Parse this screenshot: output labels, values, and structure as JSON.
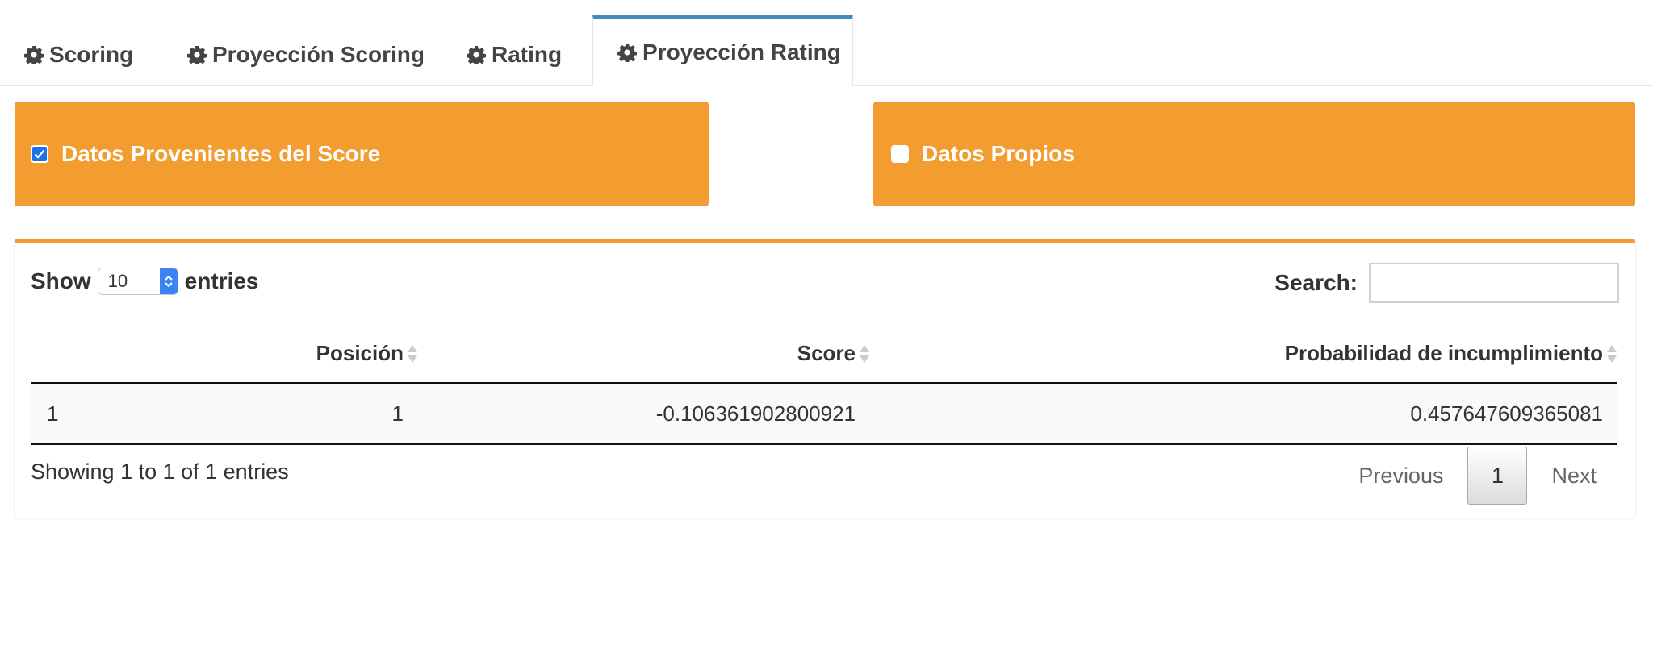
{
  "tabs": [
    {
      "label": "Scoring",
      "icon": "gear-icon"
    },
    {
      "label": "Proyección Scoring",
      "icon": "gear-icon"
    },
    {
      "label": "Rating",
      "icon": "gear-icon"
    },
    {
      "label": "Proyección Rating",
      "icon": "gear-icon",
      "active": true
    }
  ],
  "sources": {
    "score": {
      "label": "Datos Provenientes del Score",
      "checked": true
    },
    "own": {
      "label": "Datos Propios",
      "checked": false
    }
  },
  "table_controls": {
    "show_label": "Show",
    "entries_value": "10",
    "entries_label": "entries",
    "search_label": "Search:",
    "search_value": ""
  },
  "table": {
    "columns": [
      "Posición",
      "Score",
      "Probabilidad de incumplimiento"
    ],
    "rows": [
      {
        "index": "1",
        "posicion": "1",
        "score": "-0.106361902800921",
        "probabilidad": "0.457647609365081"
      }
    ]
  },
  "footer": {
    "info": "Showing 1 to 1 of 1 entries",
    "previous": "Previous",
    "current_page": "1",
    "next": "Next"
  },
  "colors": {
    "accent_orange": "#f39c2f",
    "tab_active_border": "#3c8dbc",
    "checkbox_blue": "#1a73e8"
  }
}
